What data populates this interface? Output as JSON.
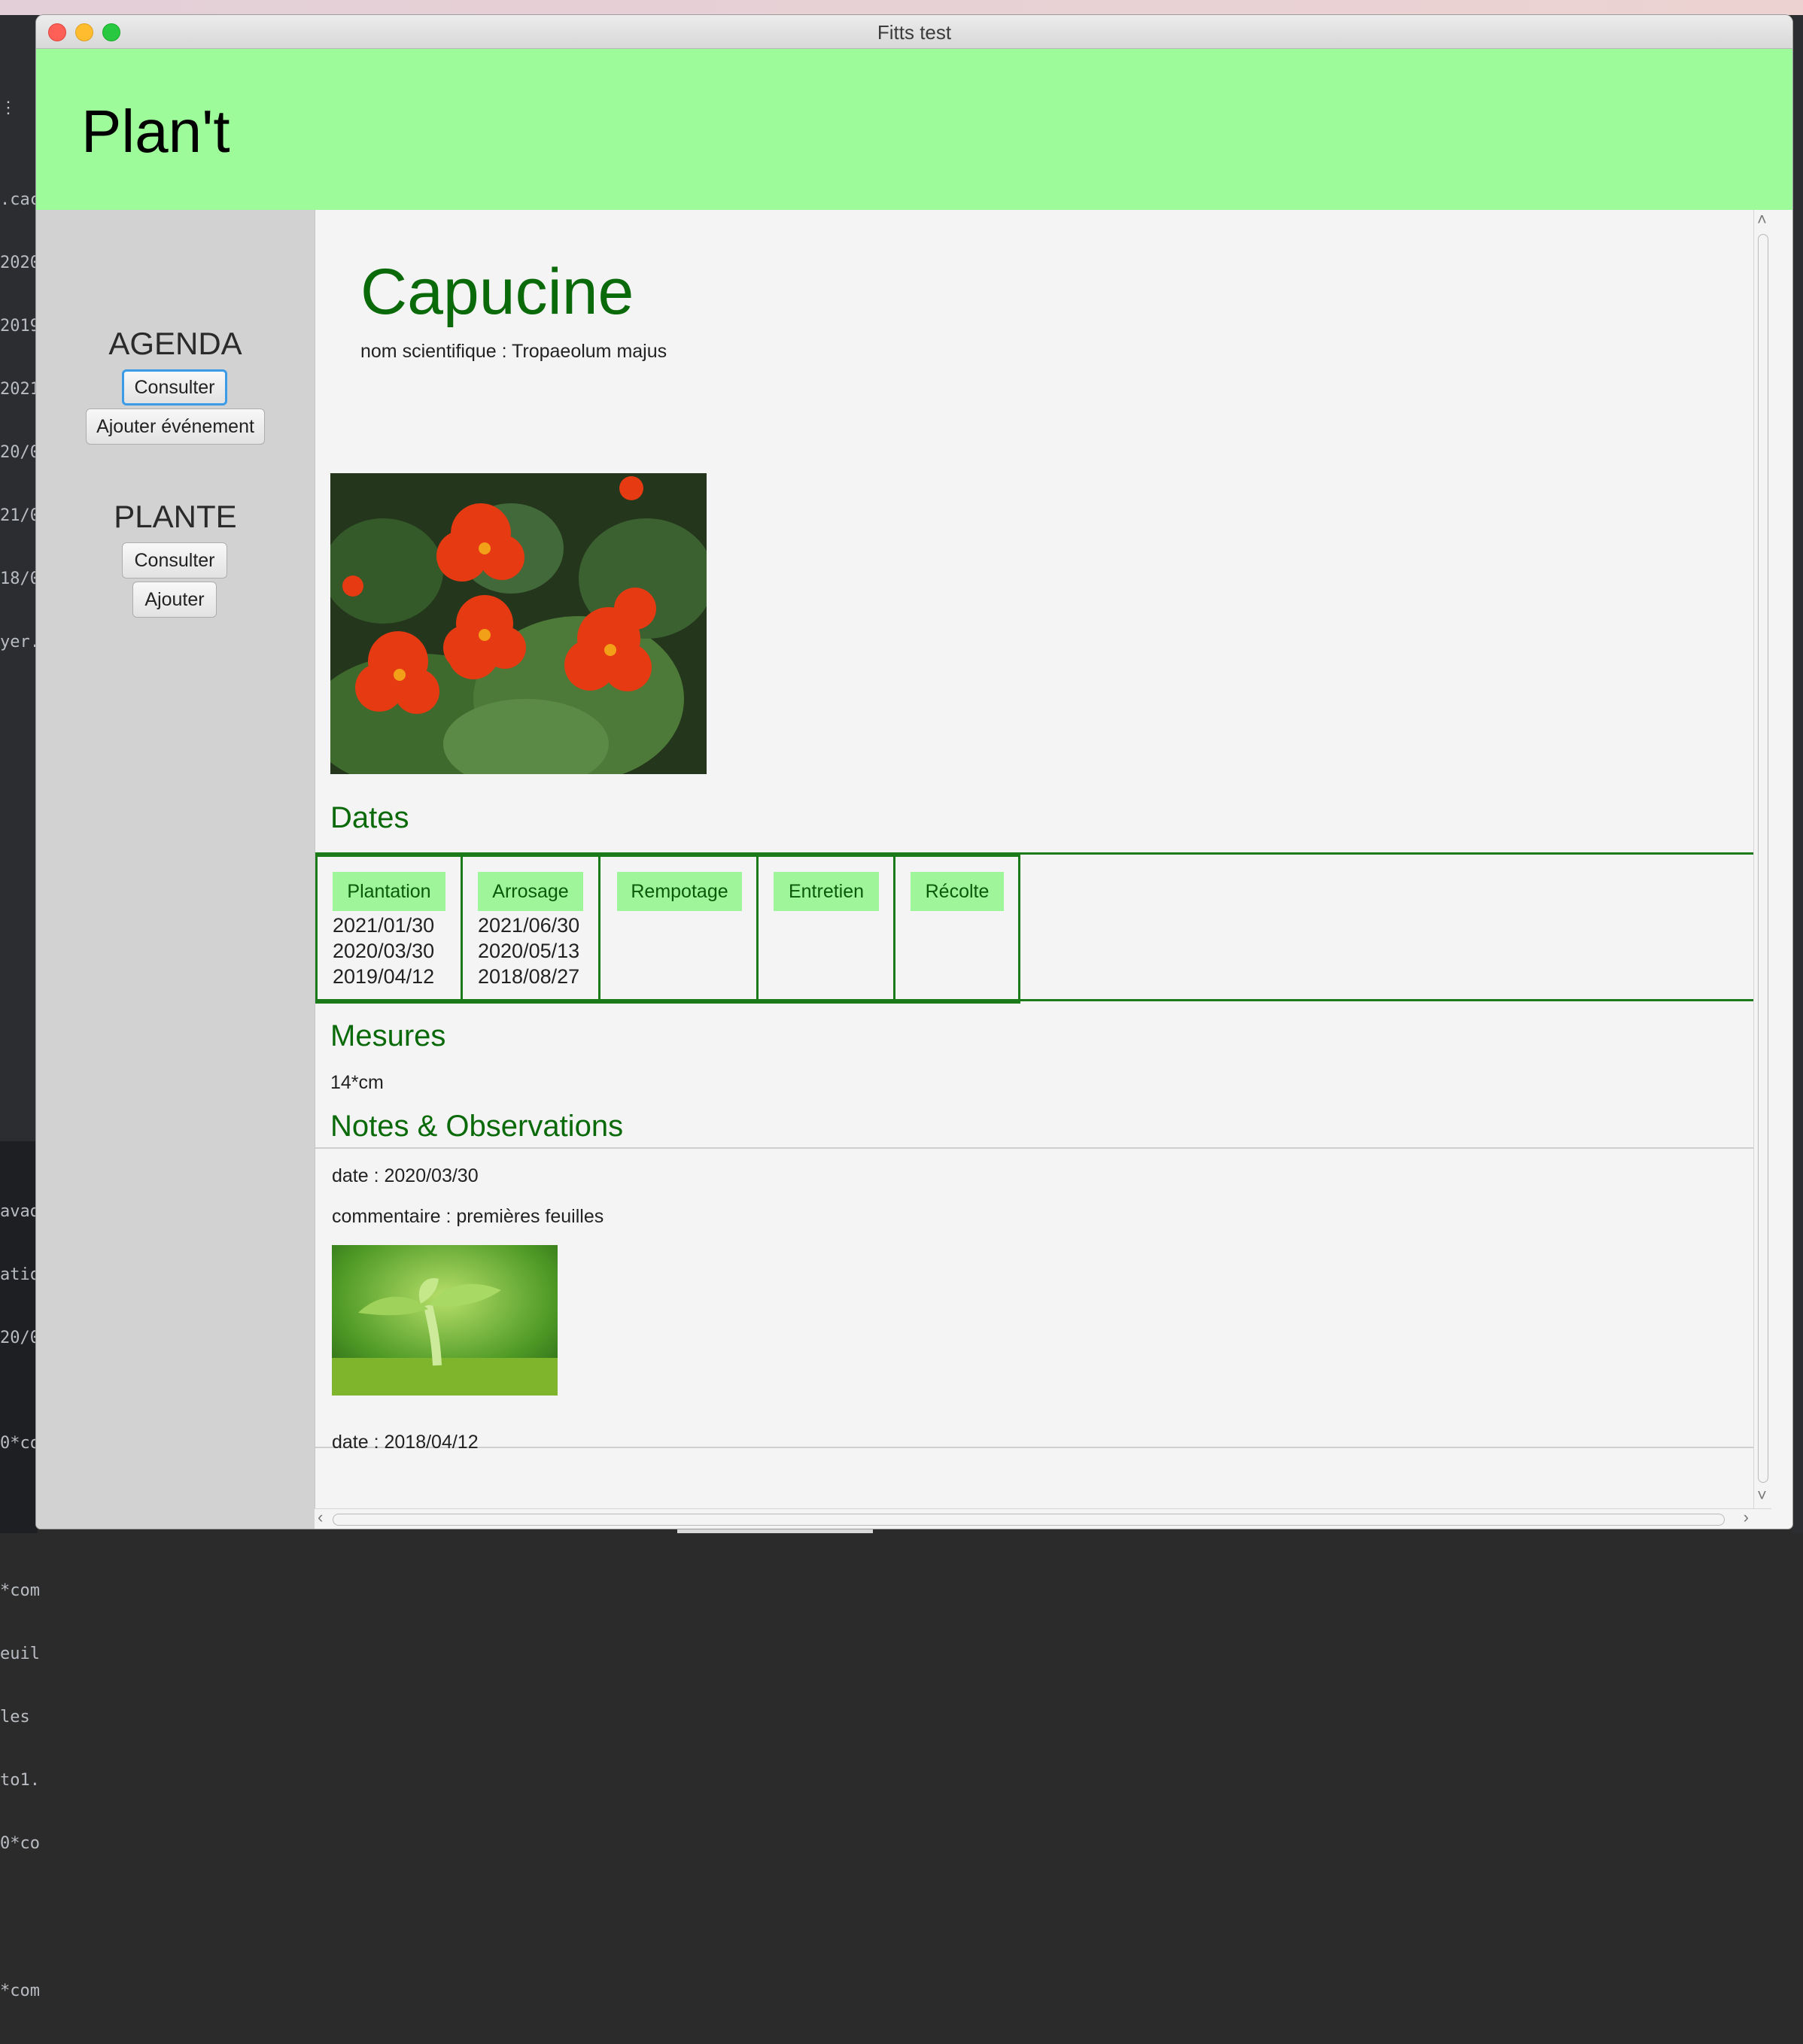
{
  "window": {
    "title": "Fitts test"
  },
  "header": {
    "app_title": "Plan't"
  },
  "sidebar": {
    "agenda": {
      "heading": "AGENDA",
      "consult_label": "Consulter",
      "add_event_label": "Ajouter événement"
    },
    "plante": {
      "heading": "PLANTE",
      "consult_label": "Consulter",
      "add_label": "Ajouter"
    }
  },
  "plant": {
    "name": "Capucine",
    "scientific_name": "nom scientifique : Tropaeolum majus"
  },
  "dates": {
    "title": "Dates",
    "columns": [
      {
        "label": "Plantation",
        "entries": [
          "2021/01/30",
          "2020/03/30",
          "2019/04/12"
        ]
      },
      {
        "label": "Arrosage",
        "entries": [
          "2021/06/30",
          "2020/05/13",
          "2018/08/27"
        ]
      },
      {
        "label": "Rempotage",
        "entries": []
      },
      {
        "label": "Entretien",
        "entries": []
      },
      {
        "label": "Récolte",
        "entries": []
      }
    ]
  },
  "mesures": {
    "title": "Mesures",
    "value": "14*cm"
  },
  "notes": {
    "title": "Notes & Observations",
    "items": [
      {
        "date": "date : 2020/03/30",
        "comment": "commentaire : premières feuilles"
      },
      {
        "date": "date : 2018/04/12"
      }
    ]
  },
  "background_editor": {
    "lines_top": [
      ".cac",
      "2020",
      "2019",
      "2021",
      "20/0",
      "21/0",
      "18/0",
      "yer."
    ],
    "lines_bottom": [
      "avado",
      "ation",
      "20/0",
      "",
      "0*co",
      "",
      "",
      "*com",
      "euil",
      "les ",
      "to1.",
      "0*co",
      "",
      "",
      "*com"
    ]
  },
  "colors": {
    "header_bg": "#9efb9a",
    "accent_green": "#0a6a0a",
    "tag_green": "#9ef59a",
    "sidebar_bg": "#d2d2d2",
    "content_bg": "#f4f4f4"
  }
}
